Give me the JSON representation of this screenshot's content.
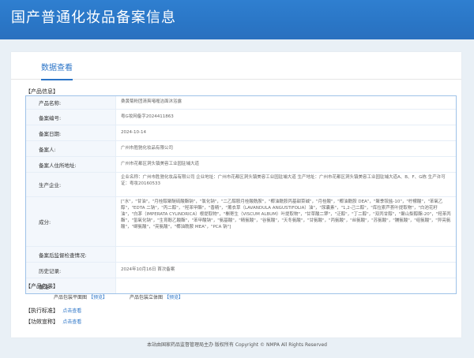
{
  "header": {
    "title": "国产普通化妆品备案信息"
  },
  "tabs": [
    {
      "label": "数据查看"
    }
  ],
  "sections": {
    "product_info": "【产品信息】",
    "product_package": "【产品包装】",
    "exec_standard": "【执行标准】",
    "efficacy": "【功效宣称】"
  },
  "rows": [
    {
      "label": "产品名称:",
      "value": "桑黄菊粉团清爽啫喱洁面沐浴露"
    },
    {
      "label": "备案编号:",
      "value": "粤G妆网备字2024411863"
    },
    {
      "label": "备案日期:",
      "value": "2024-10-14"
    },
    {
      "label": "备案人:",
      "value": "广州市胜驰化妆品有限公司"
    },
    {
      "label": "备案人住所地址:",
      "value": "广州市花都区洞头镇美容工业园驻埔大道"
    },
    {
      "label": "生产企业:",
      "value": "企业名称：广州市胜驰化妆品有限公司 企业地址：广州市花都区洞头镇美容工业园驻埔大道 生产地址：广州市花都区洞头镇美容工业园驻埔大道A、B、F、G栋 生产许可证：粤妆20160533"
    },
    {
      "label": "成分:",
      "value": "[\"水\"，\"甘油\"，\"月桂醇聚醚硫酸酯钠\"，\"氯化钠\"，\"二乙醇胺月桂酸酰胺\"，\"椰油酰胺丙基甜菜碱\"，\"月桂酸\"，\"椰油酰胺 DEA\"，\"聚季铵盐-10\"，\"柠檬酸\"，\"苯氧乙醇\"，\"EDTA 二钠\"，\"丙二醇\"，\"羟苯甲酯\"，\"香精\"，\"薰衣草（LAVANDULA ANGUSTIFOLIA）油\"，\"尿囊素\"，\"1,2-己二醇\"，\"库拉索芦荟叶提取物\"，\"白池花籽油\"，\"白茅（IMPERATA CYLINDRICA）根提取物\"，\"槲寄生（VISCUM ALBUM）叶提取物\"，\"甘草酸二钾\"，\"泛醇\"，\"丁二醇\"，\"双丙甘醇\"，\"聚山梨醇酯-20\"，\"羟苯丙酯\"，\"氢氧化钠\"，\"生育酚乙酸酯\"，\"苯甲酸钠\"，\"氨基酸\"，\"精氨酸\"，\"谷氨酸\"，\"天冬氨酸\"，\"甘氨酸\"，\"丙氨酸\"，\"丝氨酸\"，\"苏氨酸\"，\"脯氨酸\"，\"组氨酸\"，\"异亮氨酸\"，\"缬氨酸\"，\"亮氨酸\"，\"椰油酰胺 MEA\"，\"PCA 钠\"]"
    },
    {
      "label": "备案后监督检查情况:",
      "value": ""
    },
    {
      "label": "历史记录:",
      "value": "2024年10月16日 首次备案"
    },
    {
      "label": "备注:",
      "value": ""
    }
  ],
  "package": {
    "plane_label": "产品包装平面图",
    "plane_link": "【预览】",
    "solid_label": "产品包装立体图",
    "solid_link": "【预览】"
  },
  "links": {
    "exec_standard": "点击查看",
    "efficacy": "点击查看"
  },
  "footer": "本站由国家药品监督管理局主办 版权所有 Copyright © NMPA All Rights Reserved"
}
